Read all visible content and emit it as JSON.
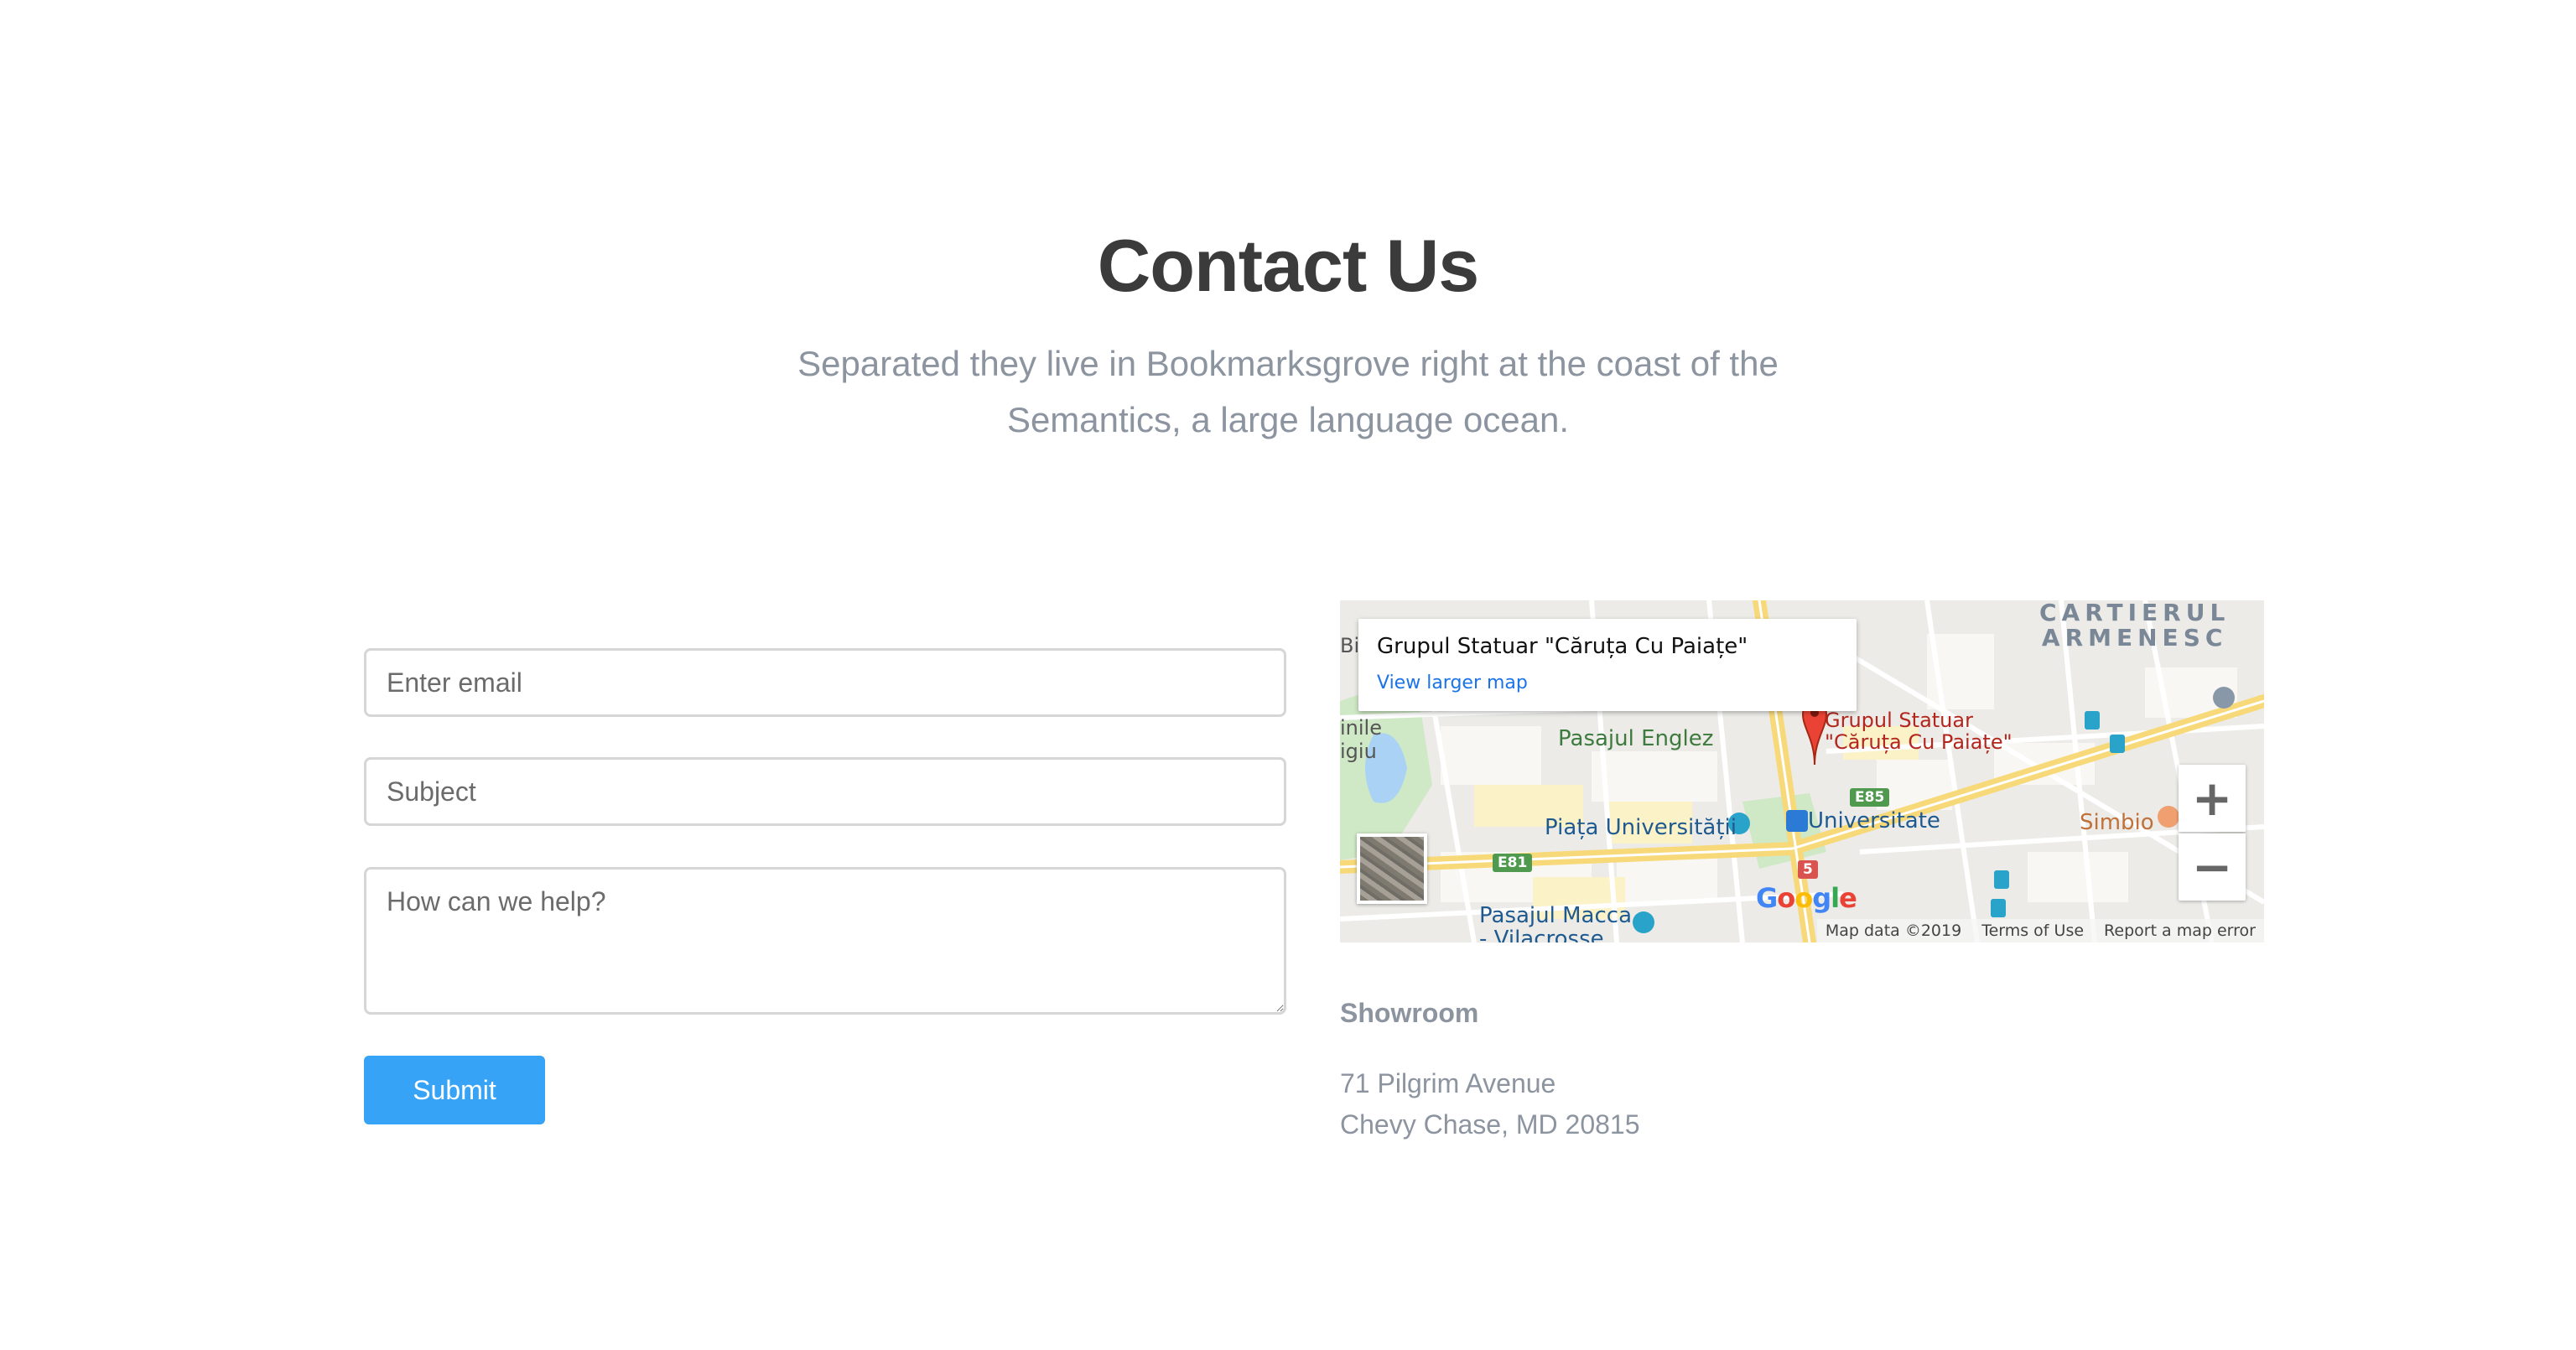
{
  "header": {
    "title": "Contact Us",
    "subtitle": "Separated they live in Bookmarksgrove right at the coast of the Semantics, a large language ocean."
  },
  "form": {
    "email_placeholder": "Enter email",
    "subject_placeholder": "Subject",
    "message_placeholder": "How can we help?",
    "submit_label": "Submit",
    "submit_color": "#36a3f7"
  },
  "map": {
    "place_name": "Grupul Statuar \"Căruța Cu Paiațe\"",
    "view_larger_label": "View larger map",
    "marker_label_line1": "Grupul Statuar",
    "marker_label_line2": "\"Căruța Cu Paiațe\"",
    "district_line1": "CARTIERUL",
    "district_line2": "ARMENESC",
    "labels": {
      "pasajul_englez": "Pasajul Englez",
      "piata_universitatii": "Piața Universității",
      "universitate": "Universitate",
      "simbio": "Simbio",
      "pasajul_macca_line1": "Pasajul Macca",
      "pasajul_macca_line2": "- Vilacrosse",
      "edge_bi": "Bi",
      "edge_inile_line1": "inile",
      "edge_inile_line2": "igiu"
    },
    "road_shields": {
      "e85": "E85",
      "e81": "E81",
      "route5": "5"
    },
    "zoom_in_symbol": "+",
    "zoom_out_symbol": "−",
    "data_attribution": "Map data ©2019",
    "terms_label": "Terms of Use",
    "report_label": "Report a map error",
    "logo_letters": [
      "G",
      "o",
      "o",
      "g",
      "l",
      "e"
    ]
  },
  "showroom": {
    "title": "Showroom",
    "address_line1": "71 Pilgrim Avenue",
    "address_line2": "Chevy Chase, MD 20815"
  }
}
